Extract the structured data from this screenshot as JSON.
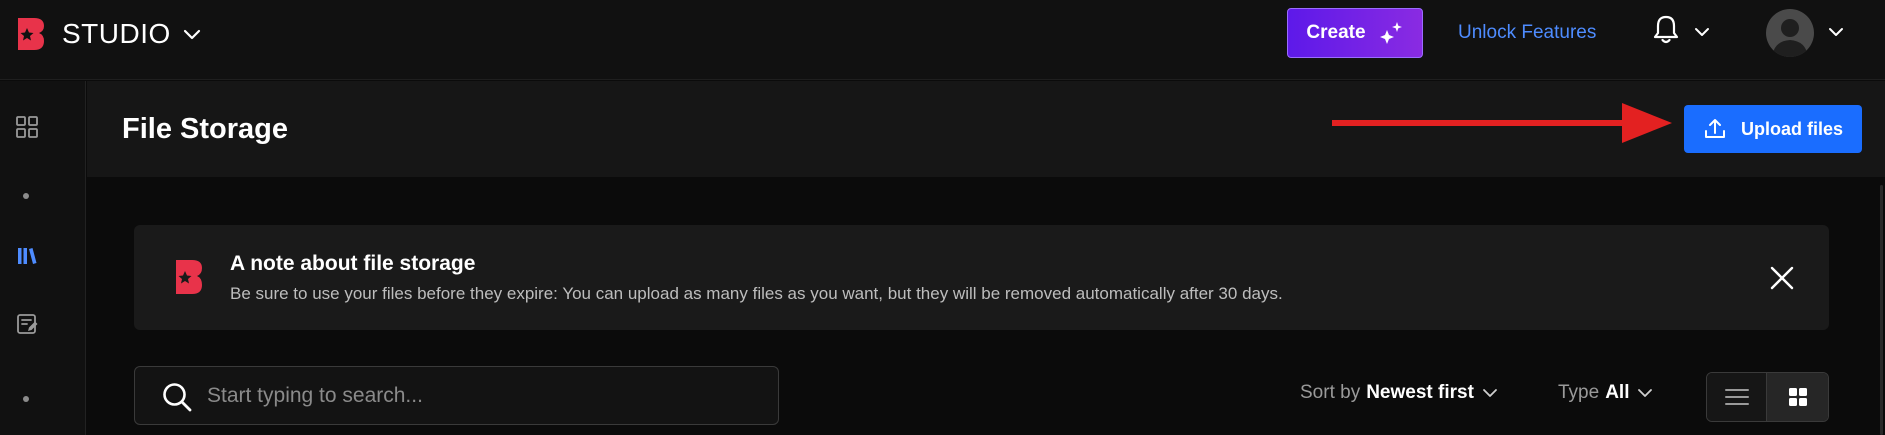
{
  "header": {
    "brand_name": "STUDIO",
    "create_label": "Create",
    "unlock_label": "Unlock Features"
  },
  "page": {
    "title": "File Storage",
    "upload_label": "Upload files"
  },
  "note": {
    "title": "A note about file storage",
    "text": "Be sure to use your files before they expire: You can upload as many files as you want, but they will be removed automatically after 30 days."
  },
  "search": {
    "placeholder": "Start typing to search..."
  },
  "sort": {
    "prefix": "Sort by",
    "value": "Newest first"
  },
  "type_filter": {
    "prefix": "Type",
    "value": "All"
  },
  "sidebar": {
    "items": [
      {
        "icon": "grid-icon"
      },
      {
        "icon": "dot-icon"
      },
      {
        "icon": "library-icon",
        "active": true
      },
      {
        "icon": "edit-note-icon"
      },
      {
        "icon": "dot-icon"
      }
    ]
  },
  "colors": {
    "brand_red": "#e8334a",
    "accent_blue": "#1a6dff",
    "link_blue": "#4e8cff",
    "create_purple": "#6a1fe8",
    "annotation_red": "#e32121"
  }
}
